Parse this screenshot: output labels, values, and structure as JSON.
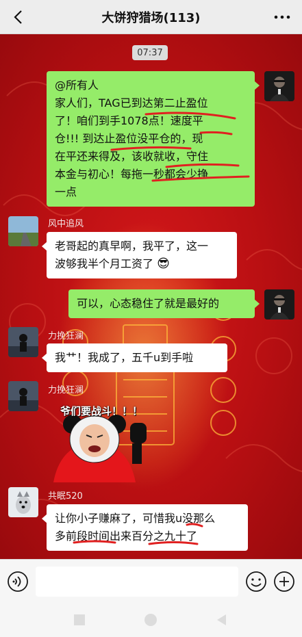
{
  "header": {
    "title": "大饼狩猎场(113)",
    "back_icon": "chevron-left-icon",
    "more_icon": "more-dots-icon"
  },
  "timestamp": "07:37",
  "messages": [
    {
      "side": "right",
      "sender": "",
      "lines": [
        "@所有人",
        "家人们，TAG已到达第二止盈位",
        "了！咱们到手1078点！速度平",
        "仓!!! 到达止盈位没平仓的，现",
        "在平还来得及，该收就收，守住",
        "本金与初心！每拖一秒都会少挣",
        "一点"
      ]
    },
    {
      "side": "left",
      "sender": "风中追风",
      "lines": [
        "老哥起的真早啊，我平了，这一",
        "波够我半个月工资了"
      ],
      "emoji": "😎"
    },
    {
      "side": "right",
      "sender": "",
      "lines": [
        "可以，心态稳住了就是最好的"
      ]
    },
    {
      "side": "left",
      "sender": "力挽狂澜",
      "lines": [
        "我艹！我成了，五千u到手啦"
      ]
    },
    {
      "side": "left",
      "sender": "力挽狂澜",
      "sticker_text": "爷们要战斗！！！"
    },
    {
      "side": "left",
      "sender": "共眠520",
      "lines": [
        "让你小子赚麻了，可惜我u没那么",
        "多前段时间出来百分之九十了"
      ]
    }
  ],
  "input": {
    "placeholder": "",
    "value": ""
  },
  "colors": {
    "header_bg": "#ededed",
    "chat_red": "#c4111a",
    "bubble_green": "#95ec69",
    "bubble_white": "#ffffff",
    "annotation_red": "#e02020"
  },
  "icons": {
    "voice": "voice-icon",
    "emoji": "emoji-icon",
    "plus": "plus-icon",
    "nav_back": "nav-back-icon",
    "nav_home": "nav-home-icon",
    "nav_recent": "nav-recent-icon"
  }
}
